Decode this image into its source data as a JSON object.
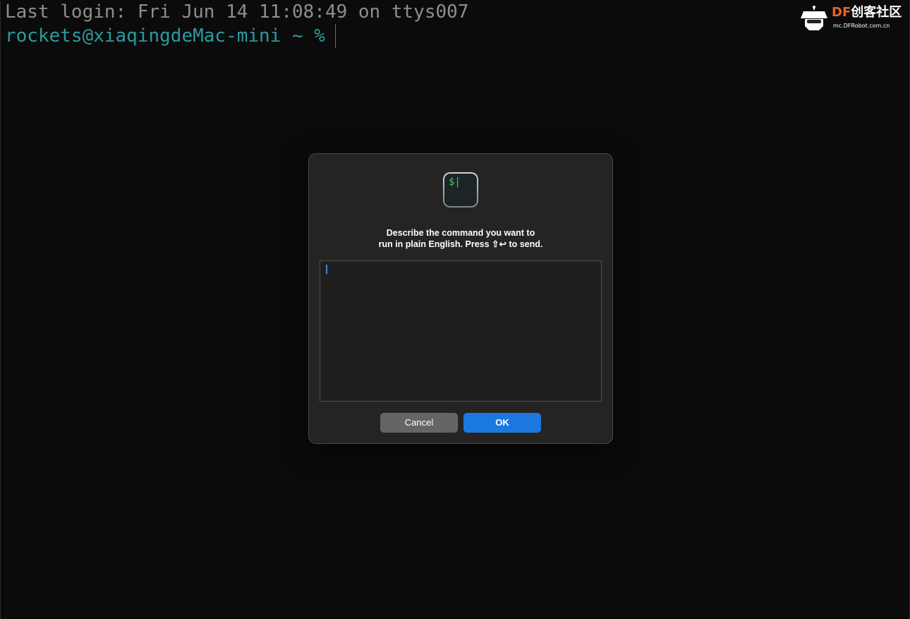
{
  "terminal": {
    "last_login": "Last login: Fri Jun 14 11:08:49 on ttys007",
    "prompt": "rockets@xiaqingdeMac-mini ~ %"
  },
  "watermark": {
    "brand": "DF",
    "brand_cn": "创客社区",
    "url": "mc.DFRobot.com.cn"
  },
  "dialog": {
    "icon": "terminal-icon",
    "icon_glyph": "$|",
    "message_line1": "Describe the command you want to",
    "message_line2": "run in plain English. Press ⇧↩ to send.",
    "input_value": "",
    "cancel_label": "Cancel",
    "ok_label": "OK"
  },
  "colors": {
    "background": "#0b0b0b",
    "login_text": "#8e8e8e",
    "prompt_text": "#2b9aa0",
    "accent": "#1a78e0",
    "caret": "#2f8cff"
  }
}
